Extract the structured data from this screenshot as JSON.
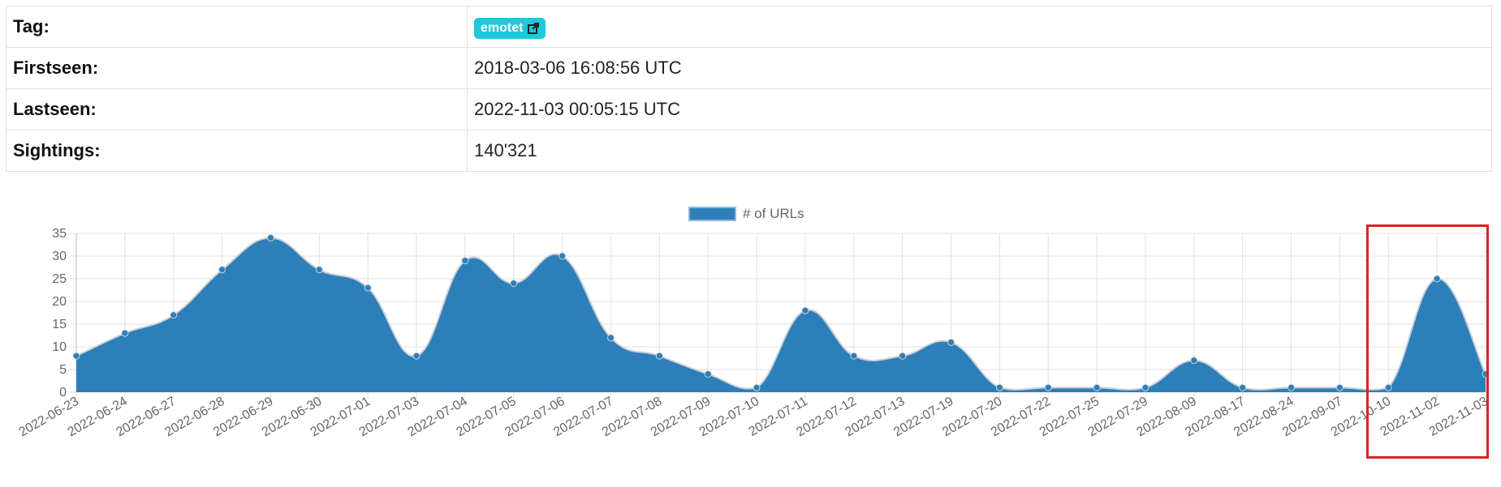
{
  "info": {
    "rows": [
      {
        "label": "Tag:",
        "value": "emotet"
      },
      {
        "label": "Firstseen:",
        "value": "2018-03-06 16:08:56 UTC"
      },
      {
        "label": "Lastseen:",
        "value": "2022-11-03 00:05:15 UTC"
      },
      {
        "label": "Sightings:",
        "value": "140'321"
      }
    ],
    "tag_color": "#1fc8db"
  },
  "chart_data": {
    "type": "area",
    "legend": {
      "label": "# of URLs",
      "position": "top"
    },
    "categories": [
      "2022-06-23",
      "2022-06-24",
      "2022-06-27",
      "2022-06-28",
      "2022-06-29",
      "2022-06-30",
      "2022-07-01",
      "2022-07-03",
      "2022-07-04",
      "2022-07-05",
      "2022-07-06",
      "2022-07-07",
      "2022-07-08",
      "2022-07-09",
      "2022-07-10",
      "2022-07-11",
      "2022-07-12",
      "2022-07-13",
      "2022-07-19",
      "2022-07-20",
      "2022-07-22",
      "2022-07-25",
      "2022-07-29",
      "2022-08-09",
      "2022-08-17",
      "2022-08-24",
      "2022-09-07",
      "2022-10-10",
      "2022-11-02",
      "2022-11-03"
    ],
    "series": [
      {
        "name": "# of URLs",
        "values": [
          8,
          13,
          17,
          27,
          34,
          27,
          23,
          8,
          29,
          24,
          30,
          12,
          8,
          4,
          1,
          18,
          8,
          8,
          11,
          1,
          1,
          1,
          1,
          7,
          1,
          1,
          1,
          1,
          25,
          4
        ]
      }
    ],
    "yticks": [
      0,
      5,
      10,
      15,
      20,
      25,
      30,
      35
    ],
    "ylim": [
      0,
      35
    ],
    "grid": true,
    "fill_color": "#2c7fb8",
    "line_color": "#c9cfd6",
    "highlight_color": "#e02020"
  }
}
